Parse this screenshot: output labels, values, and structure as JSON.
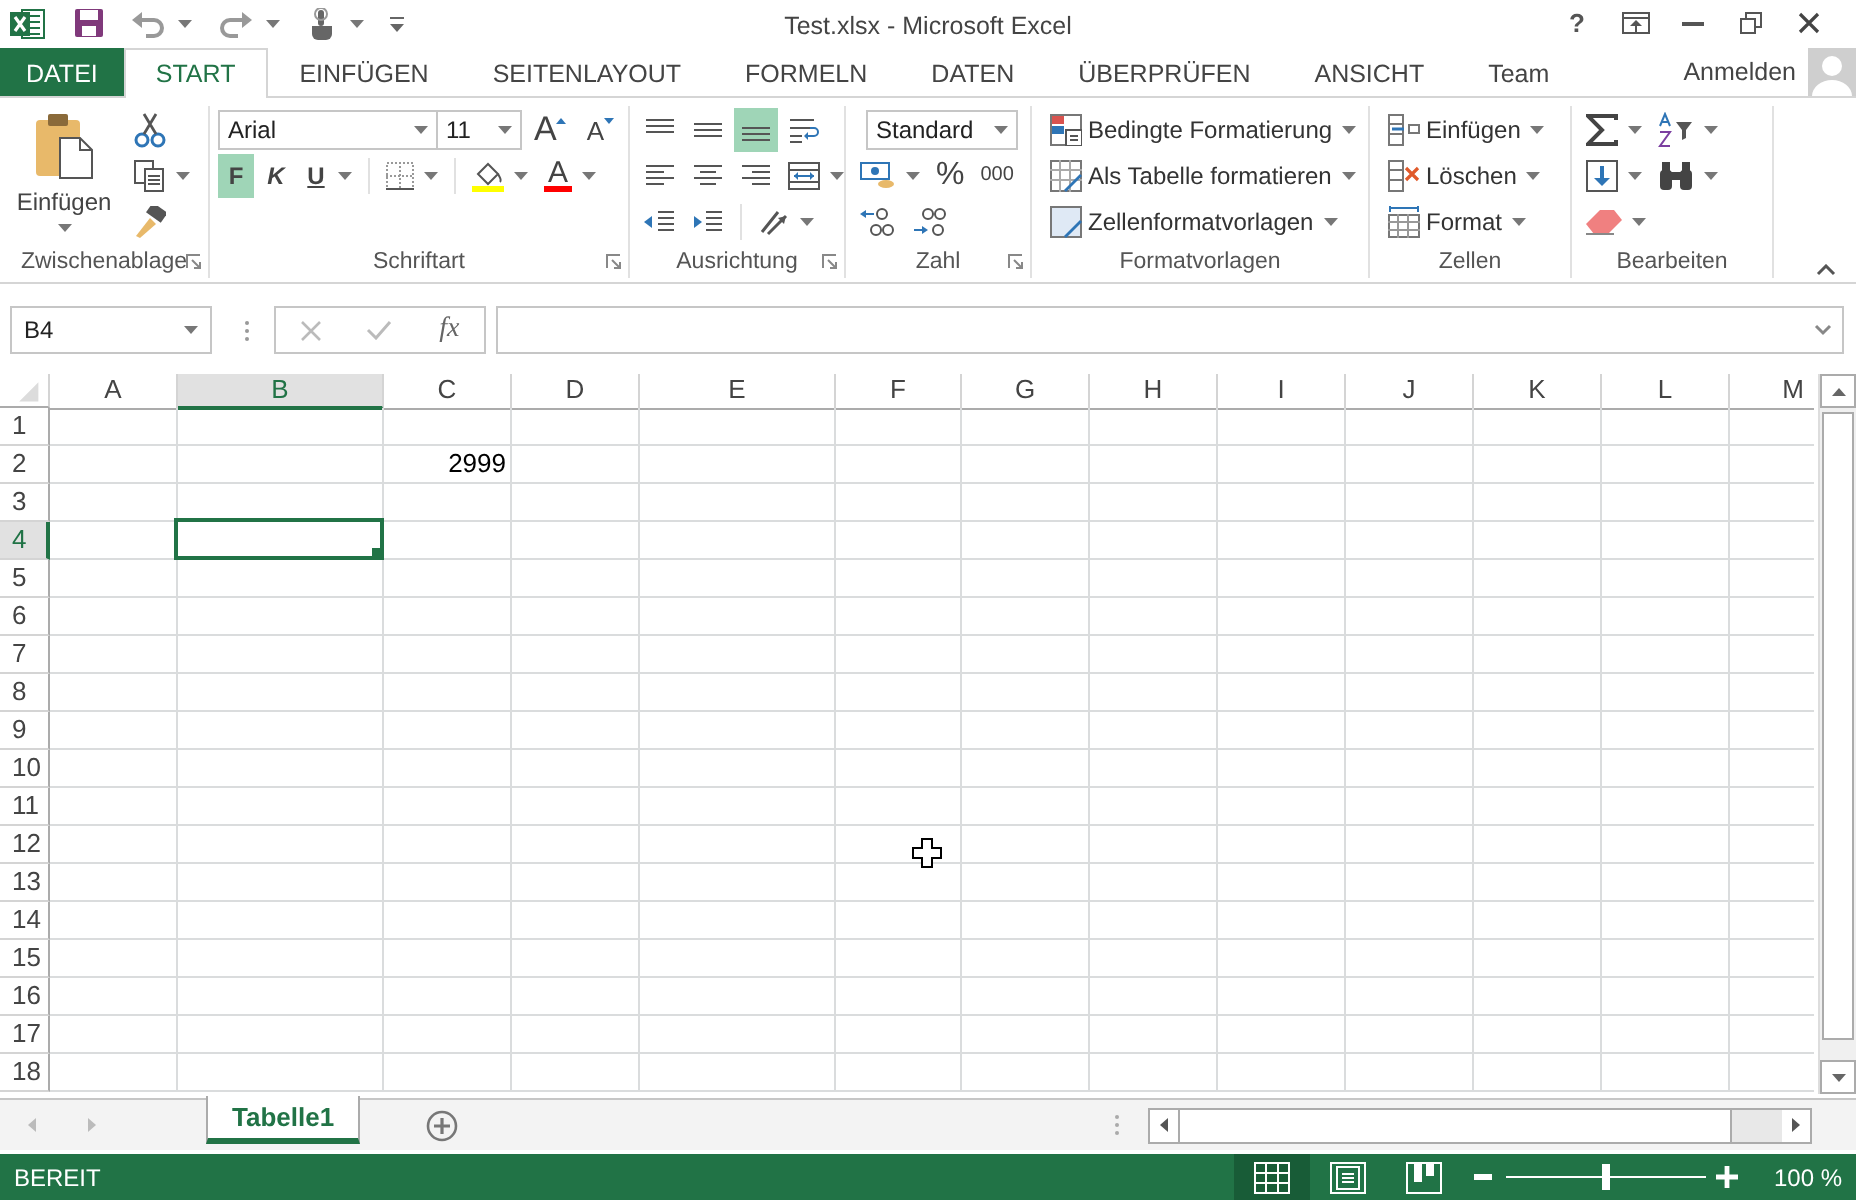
{
  "window": {
    "title": "Test.xlsx - Microsoft Excel",
    "help": "?"
  },
  "tabs": [
    {
      "label": "DATEI",
      "kind": "file",
      "selected": false
    },
    {
      "label": "START",
      "kind": "tab",
      "selected": true
    },
    {
      "label": "EINFÜGEN",
      "kind": "tab",
      "selected": false
    },
    {
      "label": "SEITENLAYOUT",
      "kind": "tab",
      "selected": false
    },
    {
      "label": "FORMELN",
      "kind": "tab",
      "selected": false
    },
    {
      "label": "DATEN",
      "kind": "tab",
      "selected": false
    },
    {
      "label": "ÜBERPRÜFEN",
      "kind": "tab",
      "selected": false
    },
    {
      "label": "ANSICHT",
      "kind": "tab",
      "selected": false
    },
    {
      "label": "Team",
      "kind": "tab",
      "selected": false
    }
  ],
  "account": {
    "label": "Anmelden"
  },
  "ribbon": {
    "groups": [
      {
        "kind": "clipboard",
        "label": "Zwischenablage",
        "launcher": true,
        "paste": "Einfügen"
      },
      {
        "kind": "font",
        "label": "Schriftart",
        "launcher": true,
        "font": "Arial",
        "size": "11",
        "grow": "A",
        "shrink": "A",
        "font_color": "A",
        "styles": [
          {
            "label": "F",
            "selected": true
          },
          {
            "label": "K",
            "selected": false
          },
          {
            "label": "U",
            "selected": false
          }
        ]
      },
      {
        "kind": "alignment",
        "label": "Ausrichtung",
        "launcher": true,
        "vertical": [
          {
            "selected": false
          },
          {
            "selected": false
          },
          {
            "selected": true
          }
        ],
        "horizontal": [
          {
            "selected": false
          },
          {
            "selected": false
          },
          {
            "selected": false
          }
        ]
      },
      {
        "kind": "number",
        "label": "Zahl",
        "launcher": true,
        "format": "Standard",
        "percent": "%",
        "thousands": "000"
      },
      {
        "kind": "styles",
        "label": "Formatvorlagen",
        "launcher": false,
        "buttons": [
          {
            "label": "Bedingte Formatierung"
          },
          {
            "label": "Als Tabelle formatieren"
          },
          {
            "label": "Zellenformatvorlagen"
          }
        ]
      },
      {
        "kind": "cells",
        "label": "Zellen",
        "launcher": false,
        "buttons": [
          {
            "label": "Einfügen"
          },
          {
            "label": "Löschen"
          },
          {
            "label": "Format"
          }
        ]
      },
      {
        "kind": "editing",
        "label": "Bearbeiten",
        "launcher": false
      }
    ]
  },
  "formula_bar": {
    "name_box": "B4",
    "function_label": "fx"
  },
  "sheet": {
    "columns": [
      {
        "label": "A",
        "selected": false
      },
      {
        "label": "B",
        "selected": true
      },
      {
        "label": "C",
        "selected": false
      },
      {
        "label": "D",
        "selected": false
      },
      {
        "label": "E",
        "selected": false
      },
      {
        "label": "F",
        "selected": false
      },
      {
        "label": "G",
        "selected": false
      },
      {
        "label": "H",
        "selected": false
      },
      {
        "label": "I",
        "selected": false
      },
      {
        "label": "J",
        "selected": false
      },
      {
        "label": "K",
        "selected": false
      },
      {
        "label": "L",
        "selected": false
      },
      {
        "label": "M",
        "selected": false
      }
    ],
    "rows": [
      {
        "label": "1",
        "selected": false
      },
      {
        "label": "2",
        "selected": false,
        "cells": [
          null,
          null,
          "2999"
        ]
      },
      {
        "label": "3",
        "selected": false
      },
      {
        "label": "4",
        "selected": true
      },
      {
        "label": "5",
        "selected": false
      },
      {
        "label": "6",
        "selected": false
      },
      {
        "label": "7",
        "selected": false
      },
      {
        "label": "8",
        "selected": false
      },
      {
        "label": "9",
        "selected": false
      },
      {
        "label": "10",
        "selected": false
      },
      {
        "label": "11",
        "selected": false
      },
      {
        "label": "12",
        "selected": false
      },
      {
        "label": "13",
        "selected": false
      },
      {
        "label": "14",
        "selected": false
      },
      {
        "label": "15",
        "selected": false
      },
      {
        "label": "16",
        "selected": false
      },
      {
        "label": "17",
        "selected": false
      },
      {
        "label": "18",
        "selected": false
      }
    ]
  },
  "sheet_tabs": [
    {
      "label": "Tabelle1",
      "selected": true
    }
  ],
  "status_bar": {
    "status": "BEREIT",
    "views": [
      {
        "selected": true
      },
      {
        "selected": false
      },
      {
        "selected": false
      }
    ],
    "zoom": {
      "level": 0.5,
      "label": "100 %"
    }
  }
}
